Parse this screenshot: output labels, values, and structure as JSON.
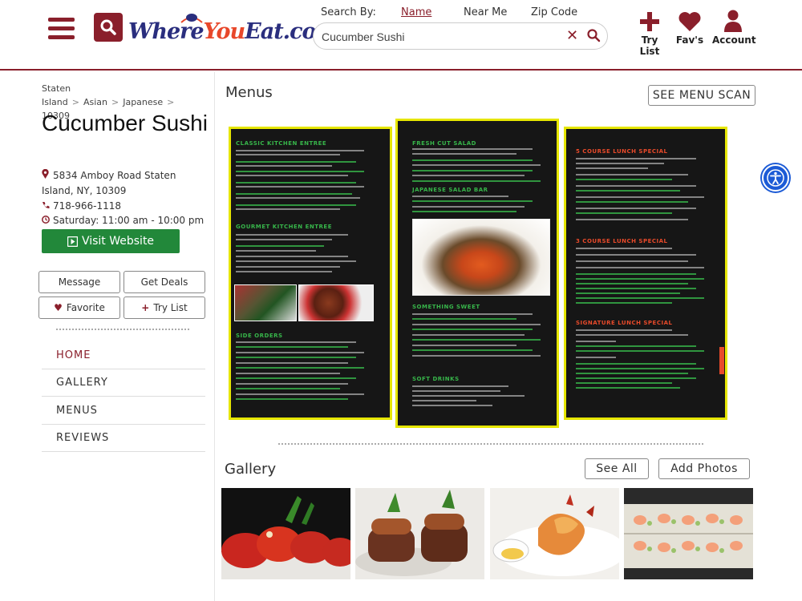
{
  "header": {
    "logo": {
      "part1": "Where",
      "part2": "You",
      "part3": "Eat.com"
    },
    "search_by_label": "Search By:",
    "search_options": [
      "Name",
      "Near Me",
      "Zip Code"
    ],
    "search_value": "Cucumber Sushi",
    "actions": {
      "try_list": "Try List",
      "favs": "Fav's",
      "account": "Account"
    }
  },
  "breadcrumb": {
    "items": [
      "Staten Island",
      "Asian",
      "Japanese",
      "10309"
    ]
  },
  "restaurant": {
    "name": "Cucumber Sushi",
    "address": "5834 Amboy Road Staten Island, NY, 10309",
    "phone": "718-966-1118",
    "hours": "Saturday: 11:00 am - 10:00 pm"
  },
  "buttons": {
    "visit_website": "Visit Website",
    "message": "Message",
    "get_deals": "Get Deals",
    "favorite": "Favorite",
    "try_list": "Try List"
  },
  "nav": [
    "HOME",
    "GALLERY",
    "MENUS",
    "REVIEWS"
  ],
  "menus": {
    "title": "Menus",
    "see_menu_scan": "SEE MENU SCAN",
    "panel1": {
      "h1": "CLASSIC KITCHEN ENTREE",
      "h2": "GOURMET KITCHEN ENTREE",
      "h3": "SIDE ORDERS"
    },
    "panel2": {
      "h1": "FRESH CUT SALAD",
      "h2": "JAPANESE SALAD BAR",
      "h3": "SOMETHING SWEET",
      "h4": "SOFT DRINKS"
    },
    "panel3": {
      "h1": "5 COURSE LUNCH SPECIAL",
      "h2": "3 COURSE LUNCH SPECIAL",
      "h3": "SIGNATURE LUNCH SPECIAL"
    }
  },
  "gallery": {
    "title": "Gallery",
    "see_all": "See All",
    "add_photos": "Add Photos"
  },
  "colors": {
    "brand": "#8a1f2b",
    "green": "#22883a",
    "menu_border": "#e6e600"
  }
}
